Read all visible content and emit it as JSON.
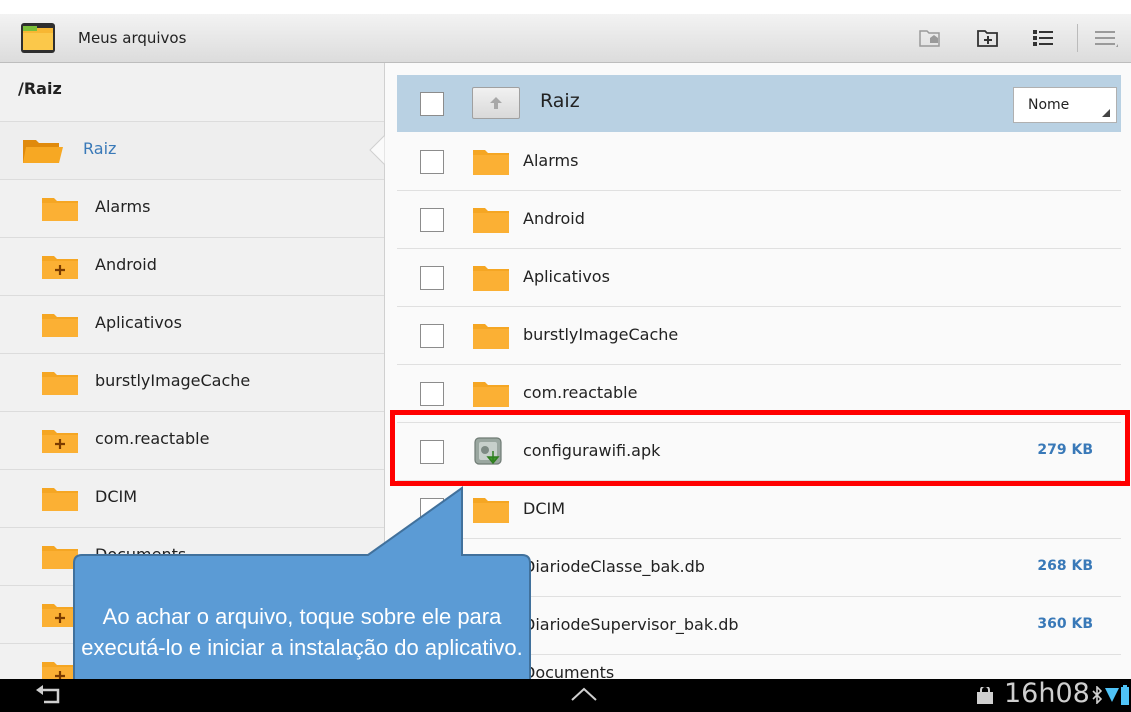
{
  "app": {
    "title": "Meus arquivos",
    "action_icons": [
      "folder-home-icon",
      "new-folder-icon",
      "list-view-icon",
      "menu-icon"
    ]
  },
  "left_panel": {
    "path": "/Raiz",
    "items": [
      {
        "label": "Raiz",
        "icon": "folder-open-icon",
        "selected": true
      },
      {
        "label": "Alarms",
        "icon": "folder-icon"
      },
      {
        "label": "Android",
        "icon": "folder-expandable-icon"
      },
      {
        "label": "Aplicativos",
        "icon": "folder-icon"
      },
      {
        "label": "burstlyImageCache",
        "icon": "folder-icon"
      },
      {
        "label": "com.reactable",
        "icon": "folder-expandable-icon"
      },
      {
        "label": "DCIM",
        "icon": "folder-icon"
      },
      {
        "label": "Documents",
        "icon": "folder-icon"
      }
    ]
  },
  "right_panel": {
    "header": {
      "title": "Raiz",
      "sort_label": "Nome"
    },
    "files": [
      {
        "name": "Alarms",
        "type": "folder",
        "size": ""
      },
      {
        "name": "Android",
        "type": "folder",
        "size": ""
      },
      {
        "name": "Aplicativos",
        "type": "folder",
        "size": ""
      },
      {
        "name": "burstlyImageCache",
        "type": "folder",
        "size": ""
      },
      {
        "name": "com.reactable",
        "type": "folder",
        "size": ""
      },
      {
        "name": "configurawifi.apk",
        "type": "apk",
        "size": "279 KB",
        "highlighted": true
      },
      {
        "name": "DCIM",
        "type": "folder",
        "size": ""
      },
      {
        "name": "DiariodeClasse_bak.db",
        "type": "file",
        "size": "268 KB"
      },
      {
        "name": "DiariodeSupervisor_bak.db",
        "type": "file",
        "size": "360 KB"
      },
      {
        "name": "Documents",
        "type": "folder",
        "size": ""
      }
    ]
  },
  "callout": {
    "text": "Ao achar o arquivo, toque sobre ele para executá-lo e iniciar a instalação do aplicativo."
  },
  "status_bar": {
    "time": "16h08"
  },
  "colors": {
    "accent_blue": "#3979b8",
    "header_bg": "#b9d1e3",
    "highlight_red": "#ff0000",
    "callout_fill": "#5b9bd5",
    "folder_orange": "#f7a823"
  }
}
